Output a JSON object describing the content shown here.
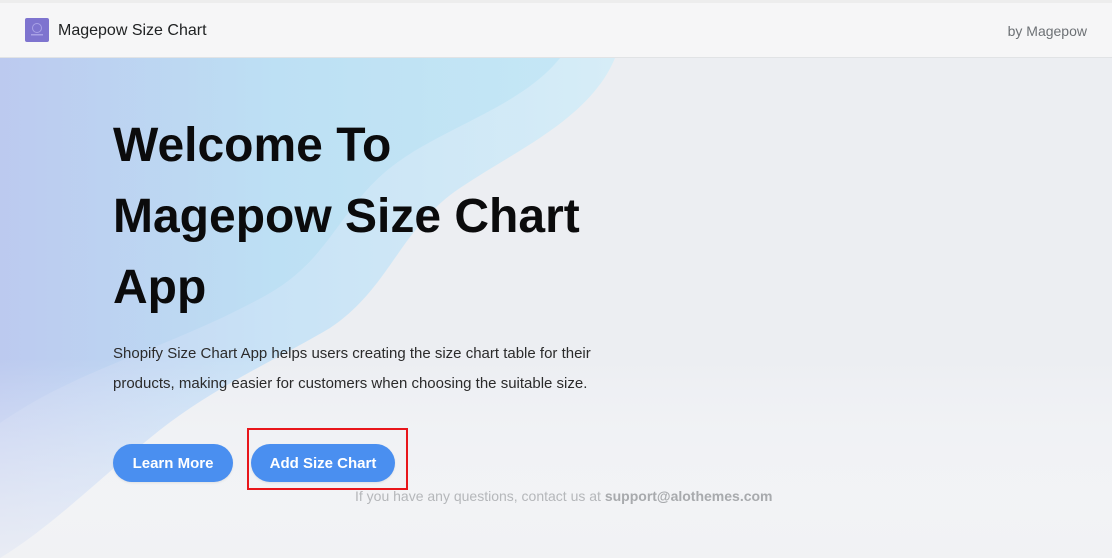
{
  "header": {
    "app_title": "Magepow Size Chart",
    "byline": "by Magepow",
    "logo_icon": "app-logo-icon"
  },
  "hero": {
    "headline_lines": [
      "Welcome To",
      "Magepow Size Chart",
      "App"
    ],
    "description_lines": [
      "Shopify Size Chart App helps users creating the size chart table for their",
      "products, making easier for customers when choosing the suitable size."
    ],
    "learn_more_label": "Learn More",
    "add_size_chart_label": "Add Size Chart",
    "contact_text": "If you have any questions, contact us at ",
    "contact_email": "support@alothemes.com"
  },
  "colors": {
    "button": "#4a8ff0",
    "highlight": "#e8161b",
    "header_bg": "#f6f6f7",
    "hero_bg": "#eceef2",
    "logo": "#7e74cf"
  }
}
